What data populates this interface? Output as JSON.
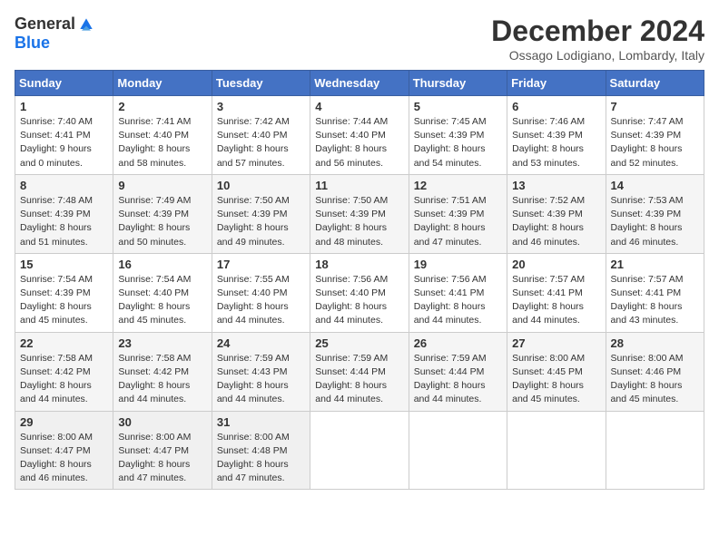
{
  "logo": {
    "general": "General",
    "blue": "Blue"
  },
  "title": "December 2024",
  "location": "Ossago Lodigiano, Lombardy, Italy",
  "days_of_week": [
    "Sunday",
    "Monday",
    "Tuesday",
    "Wednesday",
    "Thursday",
    "Friday",
    "Saturday"
  ],
  "weeks": [
    [
      {
        "day": 1,
        "sunrise": "7:40 AM",
        "sunset": "4:41 PM",
        "daylight": "9 hours and 0 minutes."
      },
      {
        "day": 2,
        "sunrise": "7:41 AM",
        "sunset": "4:40 PM",
        "daylight": "8 hours and 58 minutes."
      },
      {
        "day": 3,
        "sunrise": "7:42 AM",
        "sunset": "4:40 PM",
        "daylight": "8 hours and 57 minutes."
      },
      {
        "day": 4,
        "sunrise": "7:44 AM",
        "sunset": "4:40 PM",
        "daylight": "8 hours and 56 minutes."
      },
      {
        "day": 5,
        "sunrise": "7:45 AM",
        "sunset": "4:39 PM",
        "daylight": "8 hours and 54 minutes."
      },
      {
        "day": 6,
        "sunrise": "7:46 AM",
        "sunset": "4:39 PM",
        "daylight": "8 hours and 53 minutes."
      },
      {
        "day": 7,
        "sunrise": "7:47 AM",
        "sunset": "4:39 PM",
        "daylight": "8 hours and 52 minutes."
      }
    ],
    [
      {
        "day": 8,
        "sunrise": "7:48 AM",
        "sunset": "4:39 PM",
        "daylight": "8 hours and 51 minutes."
      },
      {
        "day": 9,
        "sunrise": "7:49 AM",
        "sunset": "4:39 PM",
        "daylight": "8 hours and 50 minutes."
      },
      {
        "day": 10,
        "sunrise": "7:50 AM",
        "sunset": "4:39 PM",
        "daylight": "8 hours and 49 minutes."
      },
      {
        "day": 11,
        "sunrise": "7:50 AM",
        "sunset": "4:39 PM",
        "daylight": "8 hours and 48 minutes."
      },
      {
        "day": 12,
        "sunrise": "7:51 AM",
        "sunset": "4:39 PM",
        "daylight": "8 hours and 47 minutes."
      },
      {
        "day": 13,
        "sunrise": "7:52 AM",
        "sunset": "4:39 PM",
        "daylight": "8 hours and 46 minutes."
      },
      {
        "day": 14,
        "sunrise": "7:53 AM",
        "sunset": "4:39 PM",
        "daylight": "8 hours and 46 minutes."
      }
    ],
    [
      {
        "day": 15,
        "sunrise": "7:54 AM",
        "sunset": "4:39 PM",
        "daylight": "8 hours and 45 minutes."
      },
      {
        "day": 16,
        "sunrise": "7:54 AM",
        "sunset": "4:40 PM",
        "daylight": "8 hours and 45 minutes."
      },
      {
        "day": 17,
        "sunrise": "7:55 AM",
        "sunset": "4:40 PM",
        "daylight": "8 hours and 44 minutes."
      },
      {
        "day": 18,
        "sunrise": "7:56 AM",
        "sunset": "4:40 PM",
        "daylight": "8 hours and 44 minutes."
      },
      {
        "day": 19,
        "sunrise": "7:56 AM",
        "sunset": "4:41 PM",
        "daylight": "8 hours and 44 minutes."
      },
      {
        "day": 20,
        "sunrise": "7:57 AM",
        "sunset": "4:41 PM",
        "daylight": "8 hours and 44 minutes."
      },
      {
        "day": 21,
        "sunrise": "7:57 AM",
        "sunset": "4:41 PM",
        "daylight": "8 hours and 43 minutes."
      }
    ],
    [
      {
        "day": 22,
        "sunrise": "7:58 AM",
        "sunset": "4:42 PM",
        "daylight": "8 hours and 44 minutes."
      },
      {
        "day": 23,
        "sunrise": "7:58 AM",
        "sunset": "4:42 PM",
        "daylight": "8 hours and 44 minutes."
      },
      {
        "day": 24,
        "sunrise": "7:59 AM",
        "sunset": "4:43 PM",
        "daylight": "8 hours and 44 minutes."
      },
      {
        "day": 25,
        "sunrise": "7:59 AM",
        "sunset": "4:44 PM",
        "daylight": "8 hours and 44 minutes."
      },
      {
        "day": 26,
        "sunrise": "7:59 AM",
        "sunset": "4:44 PM",
        "daylight": "8 hours and 44 minutes."
      },
      {
        "day": 27,
        "sunrise": "8:00 AM",
        "sunset": "4:45 PM",
        "daylight": "8 hours and 45 minutes."
      },
      {
        "day": 28,
        "sunrise": "8:00 AM",
        "sunset": "4:46 PM",
        "daylight": "8 hours and 45 minutes."
      }
    ],
    [
      {
        "day": 29,
        "sunrise": "8:00 AM",
        "sunset": "4:47 PM",
        "daylight": "8 hours and 46 minutes."
      },
      {
        "day": 30,
        "sunrise": "8:00 AM",
        "sunset": "4:47 PM",
        "daylight": "8 hours and 47 minutes."
      },
      {
        "day": 31,
        "sunrise": "8:00 AM",
        "sunset": "4:48 PM",
        "daylight": "8 hours and 47 minutes."
      },
      null,
      null,
      null,
      null
    ]
  ],
  "labels": {
    "sunrise": "Sunrise:",
    "sunset": "Sunset:",
    "daylight": "Daylight:"
  }
}
